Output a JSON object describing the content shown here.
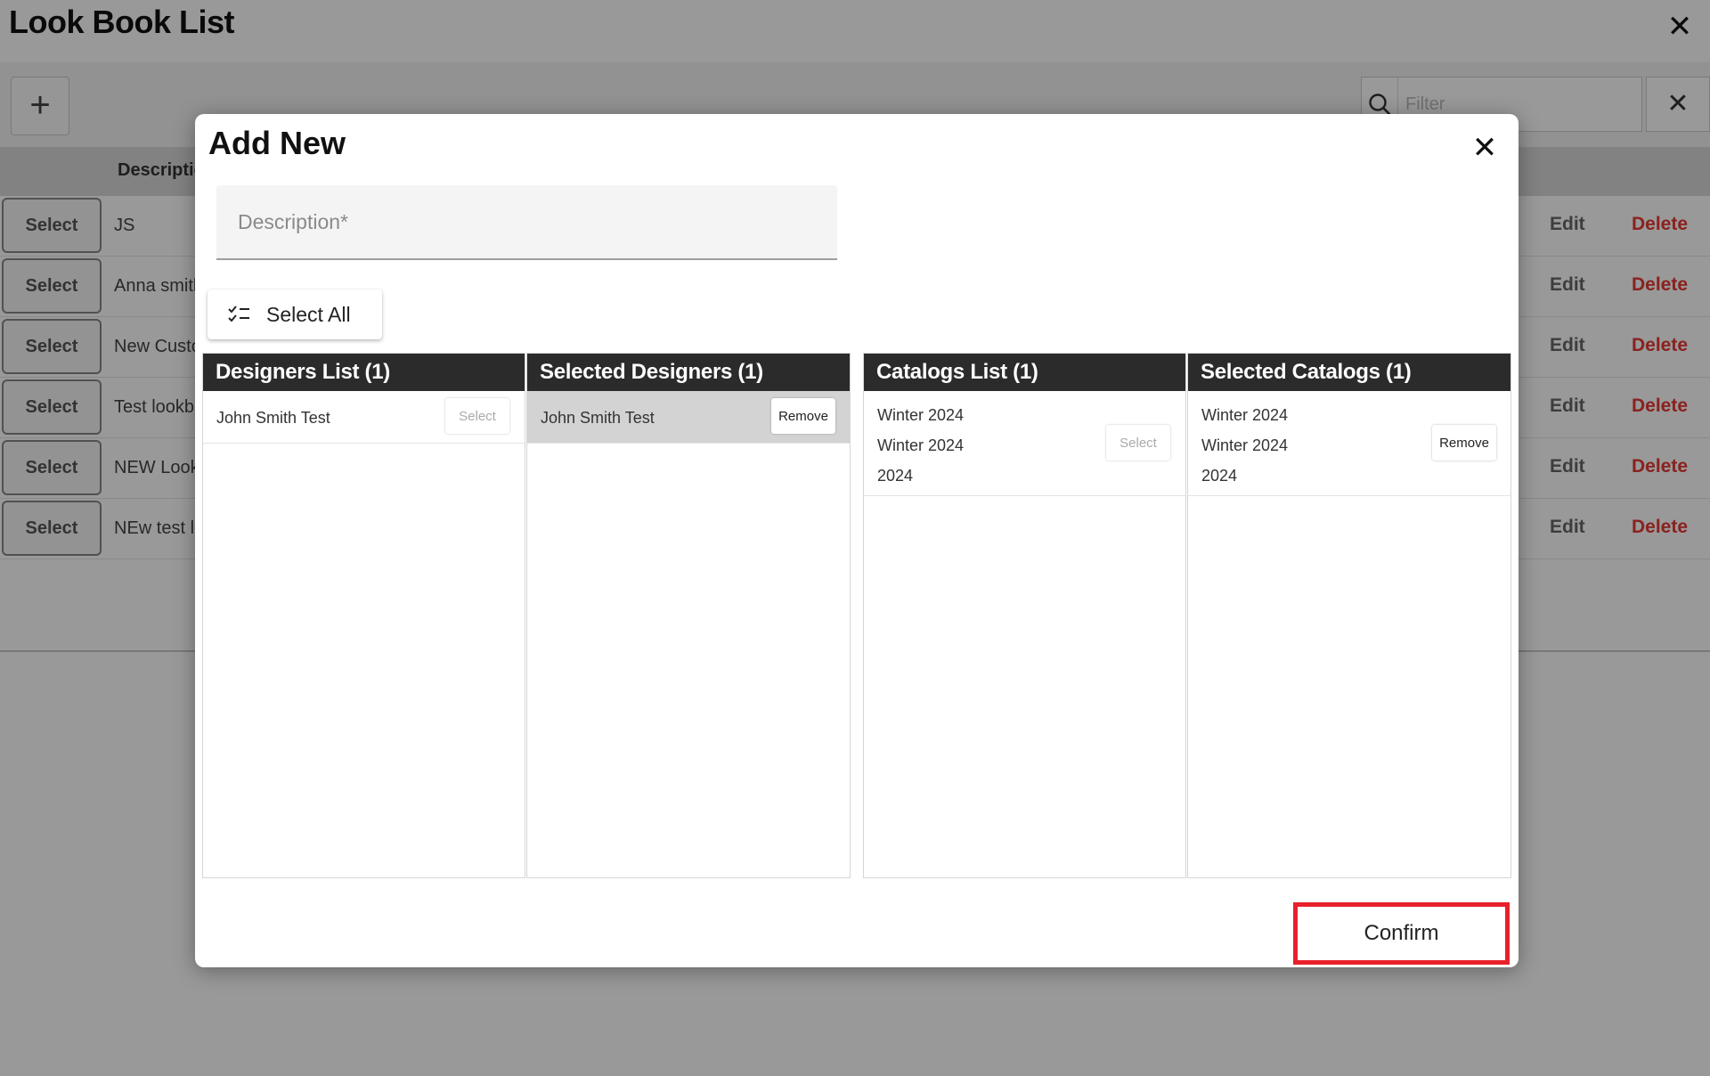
{
  "page": {
    "title": "Look Book List",
    "add_label": "+",
    "filter_placeholder": "Filter",
    "table": {
      "description_header": "Descriptio",
      "select_label": "Select",
      "edit_label": "Edit",
      "delete_label": "Delete",
      "rows": [
        {
          "description": "JS"
        },
        {
          "description": "Anna smith"
        },
        {
          "description": "New Custo"
        },
        {
          "description": "Test lookbo"
        },
        {
          "description": "NEW Look"
        },
        {
          "description": "NEw test lo"
        }
      ]
    }
  },
  "modal": {
    "title": "Add New",
    "description_placeholder": "Description*",
    "select_all_label": "Select All",
    "confirm_label": "Confirm",
    "panels": {
      "designers_list": {
        "title": "Designers List (1)",
        "items": [
          {
            "name": "John Smith Test",
            "action": "Select"
          }
        ]
      },
      "selected_designers": {
        "title": "Selected Designers (1)",
        "items": [
          {
            "name": "John Smith Test",
            "action": "Remove"
          }
        ]
      },
      "catalogs_list": {
        "title": "Catalogs List (1)",
        "items": [
          {
            "lines": [
              "Winter 2024",
              "Winter 2024",
              "2024"
            ],
            "action": "Select"
          }
        ]
      },
      "selected_catalogs": {
        "title": "Selected Catalogs (1)",
        "items": [
          {
            "lines": [
              "Winter 2024",
              "Winter 2024",
              "2024"
            ],
            "action": "Remove"
          }
        ]
      }
    }
  },
  "colors": {
    "panel_header_bg": "#2b2b2b",
    "delete_text": "#e53935",
    "confirm_highlight": "#e8202a",
    "selected_row_bg": "#d3d3d3"
  }
}
